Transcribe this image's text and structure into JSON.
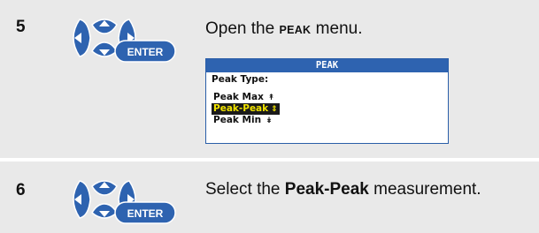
{
  "steps": [
    {
      "number": "5",
      "button_label": "ENTER",
      "text_before": "Open the ",
      "keyword": "PEAK",
      "text_after": " menu.",
      "screen": {
        "title": "PEAK",
        "heading": "Peak Type:",
        "options": [
          {
            "label": "Peak Max",
            "glyph": "↟",
            "selected": false
          },
          {
            "label": "Peak-Peak",
            "glyph": "⇕",
            "selected": true
          },
          {
            "label": "Peak Min",
            "glyph": "↡",
            "selected": false
          }
        ]
      }
    },
    {
      "number": "6",
      "button_label": "ENTER",
      "text_before": "Select the ",
      "keyword": "Peak-Peak",
      "text_after": " measurement."
    }
  ],
  "colors": {
    "row_bg": "#e9e9e9",
    "button_blue": "#2e63b0",
    "screen_title_bg": "#2e63b0",
    "highlight_bg": "#1a1a1a",
    "highlight_text": "#f2e400"
  }
}
